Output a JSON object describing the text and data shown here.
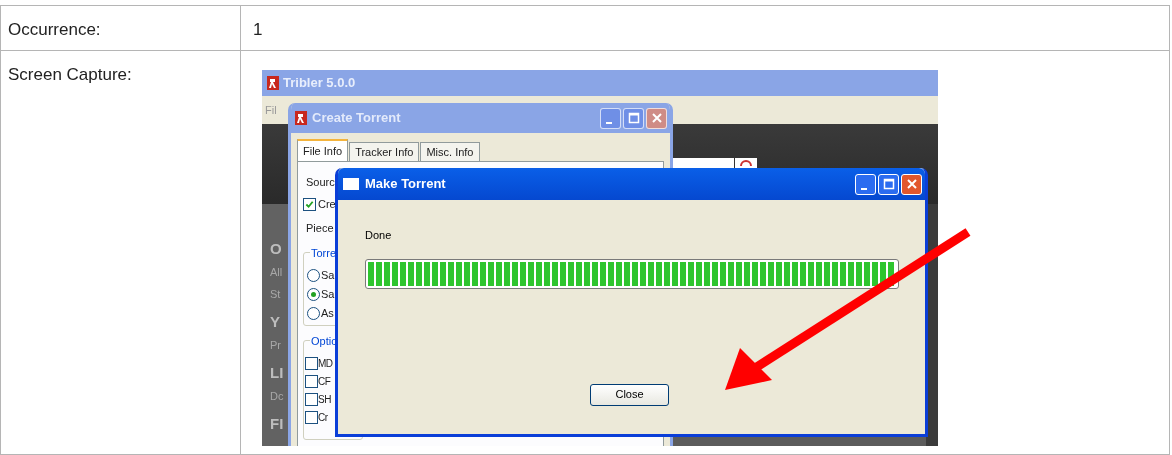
{
  "table": {
    "rows": [
      {
        "label": "Occurrence:",
        "value": "1"
      },
      {
        "label": "Screen Capture:",
        "kind": "screenshot"
      }
    ]
  },
  "screenshot": {
    "main_window": {
      "title": "Tribler 5.0.0",
      "menu": "Fil",
      "sidebar_texts": [
        {
          "text": "O",
          "kind": "heading"
        },
        {
          "text": "All",
          "kind": "item"
        },
        {
          "text": "St",
          "kind": "item"
        },
        {
          "text": "Y",
          "kind": "heading"
        },
        {
          "text": "Pr",
          "kind": "item"
        },
        {
          "text": "LI",
          "kind": "heading"
        },
        {
          "text": "Dc",
          "kind": "item"
        },
        {
          "text": "FI",
          "kind": "heading"
        }
      ]
    },
    "create_torrent": {
      "title": "Create Torrent",
      "tabs": [
        {
          "label": "File Info",
          "selected": true
        },
        {
          "label": "Tracker Info",
          "selected": false
        },
        {
          "label": "Misc. Info",
          "selected": false
        }
      ],
      "source_label": "Sourc",
      "create_checkbox": {
        "label": "Cre",
        "checked": true
      },
      "piece_label": "Piece",
      "torrent_group": {
        "title": "Torre",
        "radios": [
          {
            "label": "Sa",
            "selected": false
          },
          {
            "label": "Sa",
            "selected": true
          },
          {
            "label": "As",
            "selected": false
          }
        ]
      },
      "options_group": {
        "title": "Optic",
        "checkboxes": [
          {
            "label": "MD",
            "checked": false
          },
          {
            "label": "CF",
            "checked": false
          },
          {
            "label": "SH",
            "checked": false
          },
          {
            "label": "Cr",
            "checked": false
          }
        ]
      }
    },
    "make_torrent": {
      "title": "Make Torrent",
      "status": "Done",
      "progress": {
        "level": 1
      },
      "close_button": "Close"
    }
  }
}
